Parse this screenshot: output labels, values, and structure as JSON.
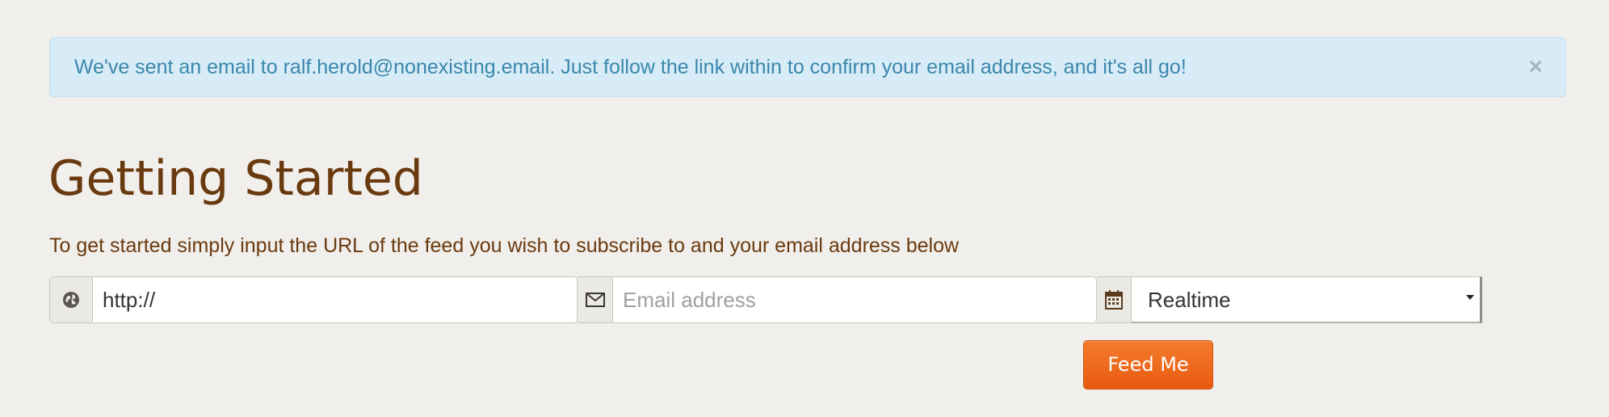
{
  "alert": {
    "message": "We've sent an email to ralf.herold@nonexisting.email. Just follow the link within to confirm your email address, and it's all go!",
    "close_label": "×"
  },
  "main": {
    "title": "Getting Started",
    "intro": "To get started simply input the URL of the feed you wish to subscribe to and your email address below"
  },
  "form": {
    "url": {
      "value": "http://",
      "icon": "globe-icon"
    },
    "email": {
      "placeholder": "Email address",
      "value": "",
      "icon": "envelope-icon"
    },
    "frequency": {
      "selected": "Realtime",
      "icon": "calendar-icon"
    },
    "submit_label": "Feed Me"
  },
  "colors": {
    "background": "#f1efeb",
    "alert_bg": "#d7ecf6",
    "alert_text": "#3a87ad",
    "heading": "#6a3a0f",
    "button": "#ef6a1e"
  }
}
